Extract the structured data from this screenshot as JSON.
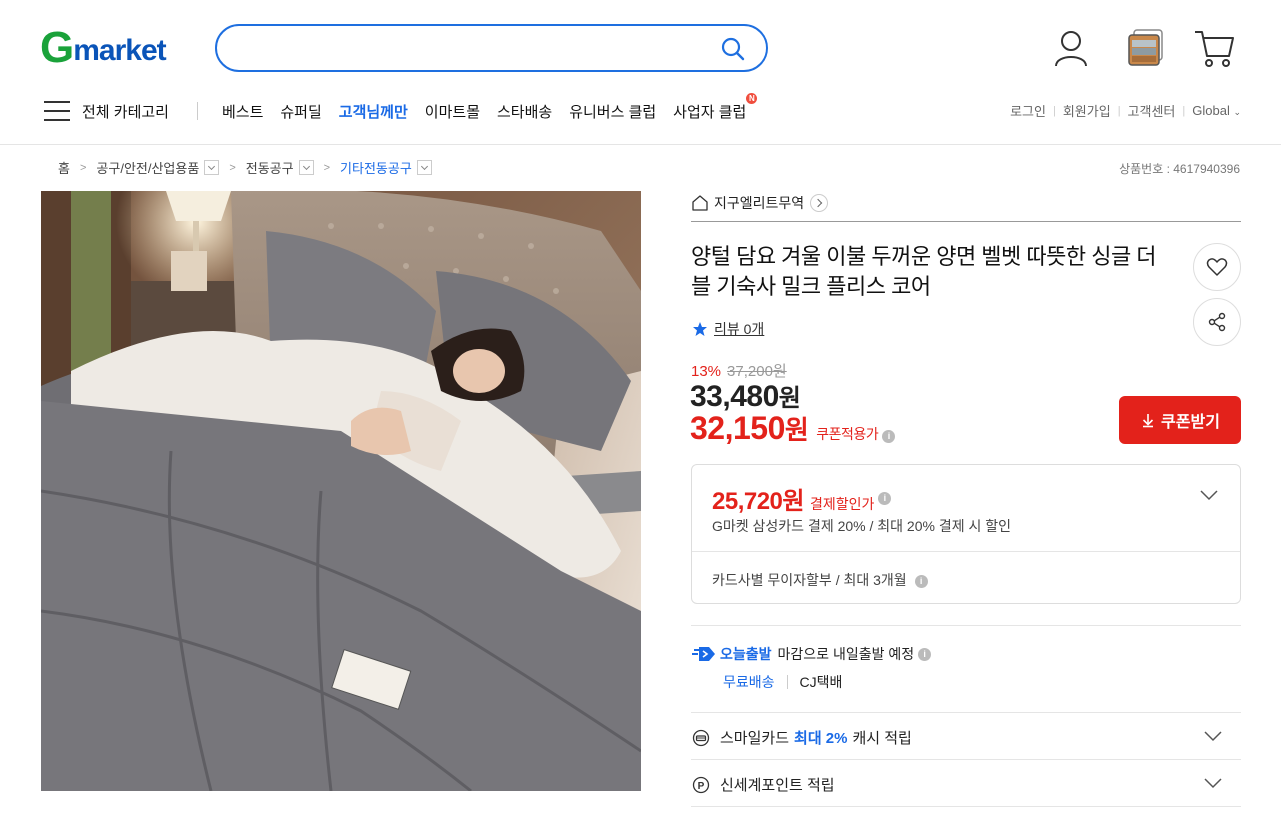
{
  "header": {
    "logo_g": "G",
    "logo_text": "market",
    "search_placeholder": "",
    "icons": [
      "user-icon",
      "recent-item-icon",
      "cart-icon"
    ]
  },
  "gnb": {
    "all_category": "전체 카테고리",
    "items": [
      {
        "label": "베스트",
        "highlight": false
      },
      {
        "label": "슈퍼딜",
        "highlight": false
      },
      {
        "label": "고객님께만",
        "highlight": true
      },
      {
        "label": "이마트몰",
        "highlight": false
      },
      {
        "label": "스타배송",
        "highlight": false
      },
      {
        "label": "유니버스 클럽",
        "highlight": false
      },
      {
        "label": "사업자 클럽",
        "highlight": false,
        "badge": "N"
      }
    ]
  },
  "util": {
    "login": "로그인",
    "signup": "회원가입",
    "cs": "고객센터",
    "global": "Global"
  },
  "breadcrumb": {
    "home": "홈",
    "cat1": "공구/안전/산업용품",
    "cat2": "전동공구",
    "cat3": "기타전동공구"
  },
  "product_no": "상품번호 : 4617940396",
  "seller": "지구엘리트무역",
  "title": "양털 담요 겨울 이불 두꺼운 양면 벨벳 따뜻한 싱글 더블 기숙사 밀크 플리스 코어",
  "review": "리뷰 0개",
  "price": {
    "discount_pct": "13%",
    "original": "37,200원",
    "sale_value": "33,480",
    "sale_won": "원",
    "coupon_value": "32,150",
    "coupon_won": "원",
    "coupon_label": "쿠폰적용가"
  },
  "coupon_button": "쿠폰받기",
  "payment": {
    "value": "25,720원",
    "label": "결제할인가",
    "desc": "G마켓 삼성카드 결제 20% / 최대 20% 결제 시 할인",
    "installment": "카드사별 무이자할부 / 최대 3개월"
  },
  "shipping": {
    "today": "오늘출발",
    "desc": "마감으로 내일출발 예정",
    "free": "무료배송",
    "courier": "CJ택배"
  },
  "benefits": [
    {
      "prefix": "스마일카드",
      "highlight": "최대 2%",
      "suffix": "캐시 적립"
    },
    {
      "prefix": "신세계포인트 적립"
    }
  ],
  "colors": {
    "brand_green": "#1aa23a",
    "brand_blue": "#0a54b8",
    "accent_blue": "#1a6ae6",
    "price_red": "#e3221b"
  }
}
